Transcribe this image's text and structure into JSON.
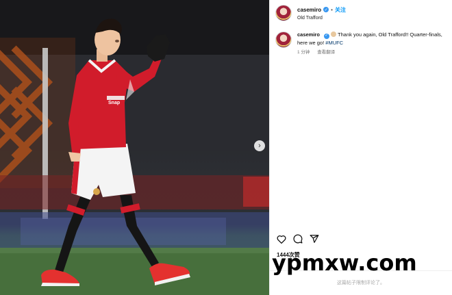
{
  "post": {
    "username": "casemiro",
    "verified_mark": "✓",
    "separator": "•",
    "follow_label": "关注",
    "location": "Old Trafford",
    "caption": {
      "username": "casemiro",
      "text": "Thank you again, Old Trafford!! Quarter-finals, here we go!",
      "hashtag": "#MUFC",
      "time_ago": "1 分钟",
      "see_translation": "查看翻译"
    },
    "likes": "1444次赞",
    "comments_disabled": "这篇帖子限制评论了。"
  },
  "media": {
    "next_arrow": "›",
    "jersey_sponsor": "Snapdragon"
  },
  "icons": {
    "like": "heart-icon",
    "comment": "comment-icon",
    "share": "share-icon",
    "next": "chevron-right-icon",
    "verified": "verified-badge-icon"
  },
  "watermark": "ypmxw.com",
  "colors": {
    "follow_blue": "#0095f6",
    "hashtag_blue": "#00376b",
    "kit_red": "#d11c2b",
    "verified_blue": "#3897f0"
  }
}
